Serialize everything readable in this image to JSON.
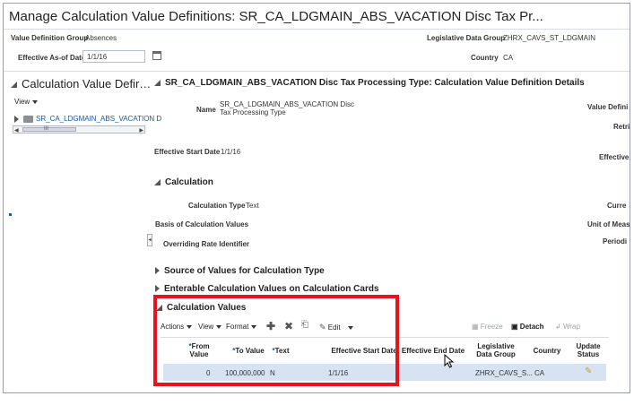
{
  "page": {
    "title": "Manage Calculation Value Definitions: SR_CA_LDGMAIN_ABS_VACATION Disc Tax Pr..."
  },
  "header": {
    "value_definition_group_label": "Value Definition Group",
    "value_definition_group_value": "Absences",
    "effective_as_of_label": "Effective As-of Date",
    "effective_as_of_value": "1/1/16",
    "legislative_group_label": "Legislative Data Group",
    "legislative_group_value": "ZHRX_CAVS_ST_LDGMAIN",
    "country_label": "Country",
    "country_value": "CA"
  },
  "left_panel": {
    "title": "Calculation Value Defir…",
    "view_menu": "View",
    "tree_item": "SR_CA_LDGMAIN_ABS_VACATION D",
    "scroll_grip": "III"
  },
  "details": {
    "title": "SR_CA_LDGMAIN_ABS_VACATION Disc Tax Processing Type: Calculation Value Definition Details",
    "name_label": "Name",
    "name_value_line1": "SR_CA_LDGMAIN_ABS_VACATION Disc",
    "name_value_line2": "Tax Processing Type",
    "value_defini_cut": "Value Defini",
    "retri_cut": "Retri",
    "effective_cut": "Effective",
    "effective_start_label": "Effective Start Date",
    "effective_start_value": "1/1/16",
    "calculation_section": "Calculation",
    "calculation_type_label": "Calculation Type",
    "calculation_type_value": "Text",
    "curre_cut": "Curre",
    "basis_label": "Basis of Calculation Values",
    "unit_cut": "Unit of Meas",
    "overriding_label": "Overriding Rate Identifier",
    "periodi_cut": "Periodi",
    "source_section": "Source of Values for Calculation Type",
    "enterable_section": "Enterable Calculation Values on Calculation Cards",
    "values_section": "Calculation Values",
    "splitter_glyph": "◂"
  },
  "toolbar": {
    "actions": "Actions",
    "view": "View",
    "format": "Format",
    "add_glyph": "✚",
    "delete_glyph": "✖",
    "detach_icon_glyph": "⎗",
    "edit": "Edit",
    "freeze": "Freeze",
    "detach": "Detach",
    "wrap": "Wrap"
  },
  "table": {
    "columns": [
      {
        "label": "From Value",
        "required": true
      },
      {
        "label": "To Value",
        "required": true
      },
      {
        "label": "Text",
        "required": true
      },
      {
        "label": "Effective Start Date",
        "required": false
      },
      {
        "label": "Effective End Date",
        "required": false
      },
      {
        "label": "Legislative Data Group",
        "required": false
      },
      {
        "label": "Country",
        "required": false
      },
      {
        "label": "Update Status",
        "required": false
      }
    ],
    "required_marker": "*",
    "rows": [
      {
        "from_value": "0",
        "to_value": "100,000,000",
        "text": "N",
        "effective_start": "1/1/16",
        "effective_end": "",
        "legislative_group": "ZHRX_CAVS_S...",
        "country": "CA",
        "update_status_icon": "✎"
      }
    ]
  },
  "colors": {
    "highlight_box": "#e8131b",
    "selected_row": "#d7e3f3",
    "link": "#1a56a8"
  }
}
